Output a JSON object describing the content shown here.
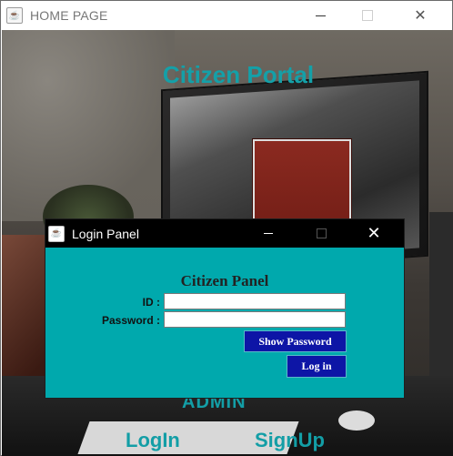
{
  "main_window": {
    "title": "HOME PAGE",
    "icon": "java-coffee-icon"
  },
  "home": {
    "portal_title": "Citizen Portal",
    "admin_label": "ADMIN",
    "login_link": "LogIn",
    "signup_link": "SignUp"
  },
  "login_dialog": {
    "title": "Login Panel",
    "icon": "java-coffee-icon",
    "heading": "Citizen Panel",
    "id_label": "ID :",
    "id_value": "",
    "password_label": "Password :",
    "password_value": "",
    "show_password_button": "Show Password",
    "login_button": "Log in"
  },
  "colors": {
    "accent_teal": "#00a9ad",
    "title_teal": "#14a0a8",
    "button_blue": "#0d15a6"
  }
}
